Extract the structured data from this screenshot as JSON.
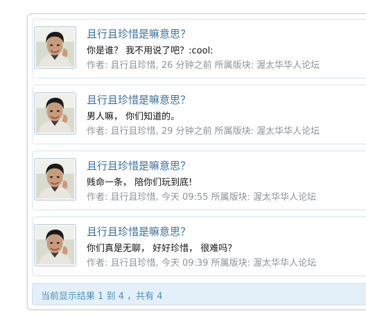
{
  "posts": [
    {
      "title": "且行且珍惜是嘛意思？",
      "content": "你是谁？ 我不用说了吧？:cool:",
      "author_label": "作者:",
      "author": "且行且珍惜",
      "time": "26 分钟之前",
      "forum_label": "所属版块:",
      "forum": "渥太华华人论坛"
    },
    {
      "title": "且行且珍惜是嘛意思？",
      "content": "男人嘛， 你们知道的。",
      "author_label": "作者:",
      "author": "且行且珍惜",
      "time": "29 分钟之前",
      "forum_label": "所属版块:",
      "forum": "渥太华华人论坛"
    },
    {
      "title": "且行且珍惜是嘛意思？",
      "content": "贱命一条， 陪你们玩到底!",
      "author_label": "作者:",
      "author": "且行且珍惜",
      "time": "今天 09:55",
      "forum_label": "所属版块:",
      "forum": "渥太华华人论坛"
    },
    {
      "title": "且行且珍惜是嘛意思？",
      "content": "你们真是无聊， 好好珍惜， 很难吗？",
      "author_label": "作者:",
      "author": "且行且珍惜",
      "time": "今天 09:39",
      "forum_label": "所属版块:",
      "forum": "渥太华华人论坛"
    }
  ],
  "footer": {
    "results_text": "当前显示结果 1 到 4 ，共有 4"
  },
  "colors": {
    "title": "#3a6f9c",
    "meta": "#8b9299",
    "footer_bg": "#e4f0f9",
    "footer_text": "#4f8fbd"
  },
  "icons": {
    "avatar": "user-avatar-photo"
  }
}
